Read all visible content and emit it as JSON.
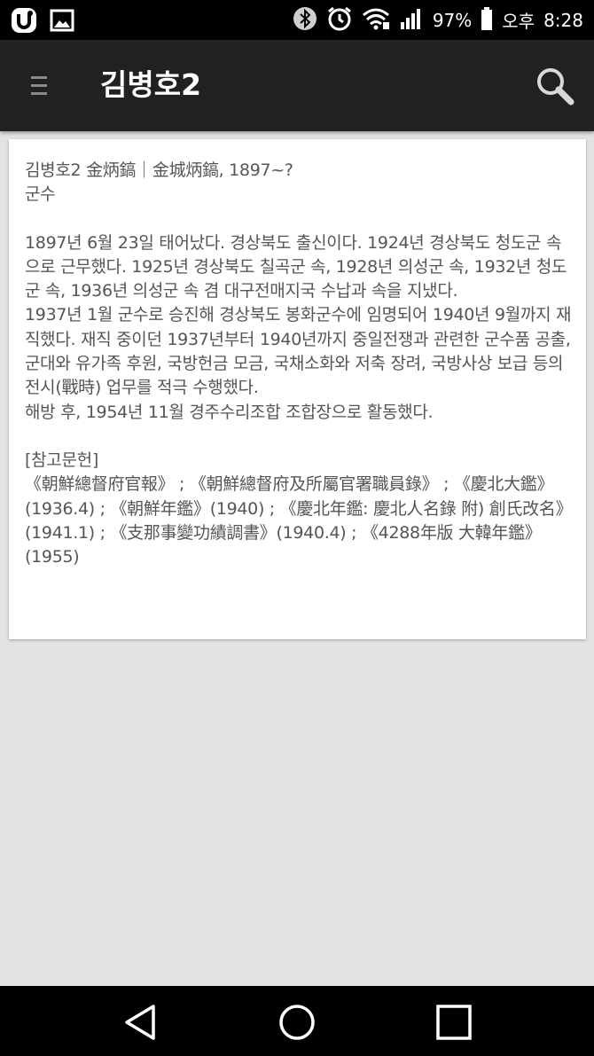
{
  "status_bar": {
    "left_icons": [
      "carrier-u-icon",
      "gallery-icon"
    ],
    "right_icons": [
      "bluetooth-icon",
      "alarm-icon",
      "wifi-icon",
      "signal-icon"
    ],
    "battery_text": "97%",
    "battery_icon": "battery-icon",
    "time_period": "오후",
    "time": "8:28"
  },
  "app_bar": {
    "menu_icon": "hamburger-menu-icon",
    "title": "김병호2",
    "search_icon": "search-icon"
  },
  "article": {
    "heading": "김병호2 金炳鎬｜金城炳鎬, 1897~?",
    "subtitle": "군수",
    "body": [
      "1897년 6월 23일 태어났다. 경상북도 출신이다. 1924년 경상북도 청도군 속으로 근무했다. 1925년 경상북도 칠곡군 속, 1928년 의성군 속, 1932년 청도군 속, 1936년 의성군 속 겸 대구전매지국 수납과 속을 지냈다.",
      "1937년 1월 군수로 승진해 경상북도 봉화군수에 임명되어 1940년 9월까지 재직했다. 재직 중이던 1937년부터 1940년까지 중일전쟁과 관련한 군수품 공출, 군대와 유가족 후원, 국방헌금 모금, 국채소화와 저축 장려, 국방사상 보급 등의 전시(戰時) 업무를 적극 수행했다.",
      "해방 후, 1954년 11월 경주수리조합 조합장으로 활동했다."
    ],
    "references_heading": "[참고문헌]",
    "references": "《朝鮮總督府官報》 ; 《朝鮮總督府及所屬官署職員錄》 ; 《慶北大鑑》(1936.4) ; 《朝鮮年鑑》(1940) ; 《慶北年鑑: 慶北人名錄 附) 創氏改名》(1941.1) ; 《支那事變功績調書》(1940.4) ; 《4288年版 大韓年鑑》(1955)"
  },
  "nav_bar": {
    "back_icon": "back-triangle-icon",
    "home_icon": "home-circle-icon",
    "recents_icon": "recents-square-icon"
  },
  "colors": {
    "status_bar": "#000000",
    "app_bar": "#212121",
    "background": "#e3e3e3",
    "card": "#ffffff",
    "body_text": "#555555"
  }
}
